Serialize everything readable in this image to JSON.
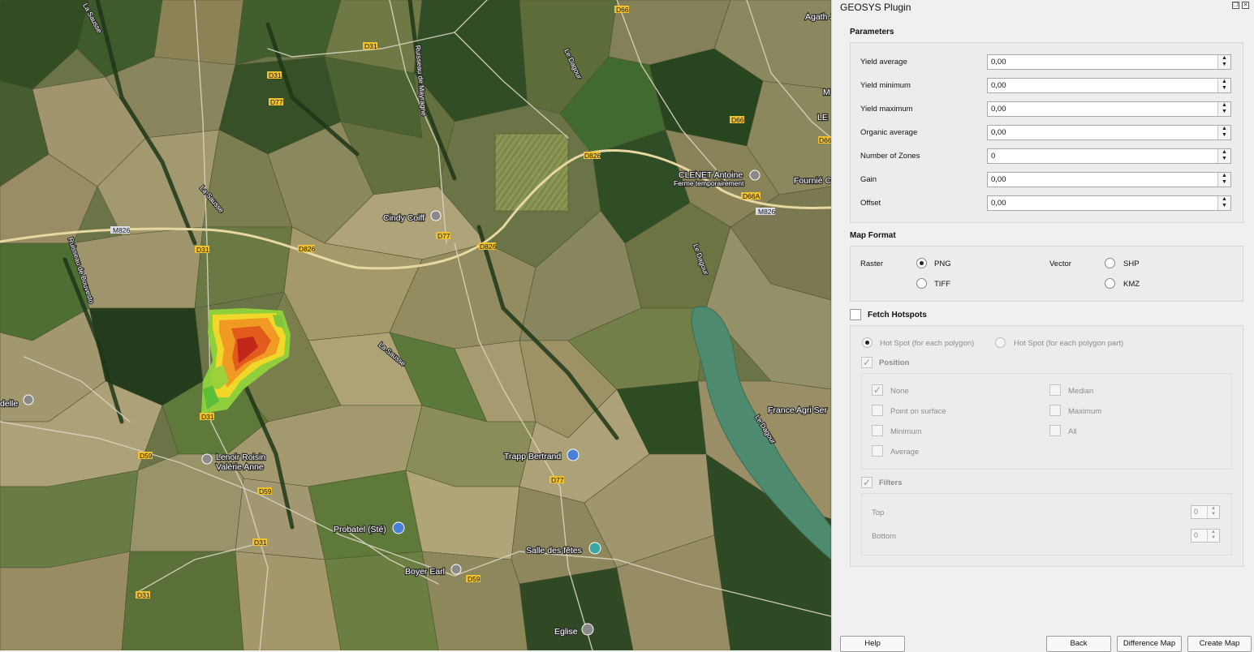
{
  "map": {
    "road_labels": [
      "La Sausse",
      "D66",
      "D31",
      "D31",
      "D77",
      "Ruisseau de Mayragne",
      "Le Dagour",
      "D66",
      "D66",
      "D826",
      "D66A",
      "M826",
      "M826",
      "D31",
      "D826",
      "D826",
      "D77",
      "Ruisseau de Bouvesto",
      "La Sausse",
      "La Sausse",
      "Le Dagour",
      "Le Dagour",
      "D31",
      "D59",
      "D59",
      "D77",
      "D31",
      "D59",
      "D31"
    ],
    "places": [
      {
        "name": "CLENET Antoine",
        "sub": "Ferme temporairement"
      },
      {
        "name": "Fournié C"
      },
      {
        "name": "Agath Jonatha"
      },
      {
        "name": "LE"
      },
      {
        "name": "M"
      },
      {
        "name": "Cindy Coiff"
      },
      {
        "name": "delle"
      },
      {
        "name": "Lenoir Roisin",
        "sub": "Valérie Anne"
      },
      {
        "name": "Trapp Bertrand"
      },
      {
        "name": "Probatel (Sté)"
      },
      {
        "name": "Salle des fêtes"
      },
      {
        "name": "Boyer Earl"
      },
      {
        "name": "Eglise"
      },
      {
        "name": "France Agri Ser"
      }
    ]
  },
  "panel": {
    "title": "GEOSYS Plugin",
    "parameters_title": "Parameters",
    "params": [
      {
        "label": "Yield average",
        "value": "0,00"
      },
      {
        "label": "Yield minimum",
        "value": "0,00"
      },
      {
        "label": "Yield maximum",
        "value": "0,00"
      },
      {
        "label": "Organic average",
        "value": "0,00"
      },
      {
        "label": "Number of Zones",
        "value": "0"
      },
      {
        "label": "Gain",
        "value": "0,00"
      },
      {
        "label": "Offset",
        "value": "0,00"
      }
    ],
    "map_format_title": "Map Format",
    "raster_label": "Raster",
    "vector_label": "Vector",
    "raster_options": [
      {
        "label": "PNG",
        "selected": true
      },
      {
        "label": "TIFF",
        "selected": false
      }
    ],
    "vector_options": [
      {
        "label": "SHP",
        "selected": false
      },
      {
        "label": "KMZ",
        "selected": false
      }
    ],
    "fetch_hotspots": {
      "label": "Fetch Hotspots",
      "checked": false
    },
    "hotspot_modes": [
      {
        "label": "Hot Spot (for each polygon)",
        "selected": true
      },
      {
        "label": "Hot Spot (for each polygon part)",
        "selected": false
      }
    ],
    "position": {
      "label": "Position",
      "checked": true
    },
    "position_options": [
      {
        "label": "None",
        "checked": true
      },
      {
        "label": "Point on surface",
        "checked": false
      },
      {
        "label": "Minimum",
        "checked": false
      },
      {
        "label": "Average",
        "checked": false
      },
      {
        "label": "Median",
        "checked": false
      },
      {
        "label": "Maximum",
        "checked": false
      },
      {
        "label": "All",
        "checked": false
      }
    ],
    "filters": {
      "label": "Filters",
      "checked": true
    },
    "filter_top": {
      "label": "Top",
      "value": "0"
    },
    "filter_bottom": {
      "label": "Bottom",
      "value": "0"
    },
    "buttons": {
      "help": "Help",
      "back": "Back",
      "difference": "Difference Map",
      "create": "Create Map"
    }
  }
}
